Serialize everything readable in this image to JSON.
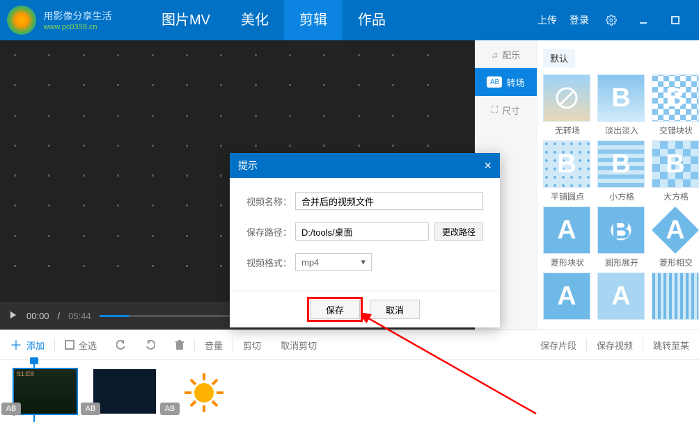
{
  "header": {
    "slogan": "用影像分享生活",
    "url": "www.pc0359.cn",
    "tabs": [
      "图片MV",
      "美化",
      "剪辑",
      "作品"
    ],
    "active_tab": "剪辑",
    "upload": "上传",
    "login": "登录"
  },
  "player": {
    "current": "00:00",
    "total": "05:44"
  },
  "side_tabs": {
    "music": "配乐",
    "transition": "转场",
    "size": "尺寸",
    "active": "转场"
  },
  "gallery": {
    "default_label": "默认",
    "items": [
      "无转场",
      "淡出淡入",
      "交错块状",
      "平铺圆点",
      "小方格",
      "大方格",
      "菱形块状",
      "圆形展开",
      "菱形相交",
      "",
      "",
      ""
    ]
  },
  "toolbar": {
    "add": "添加",
    "select_all": "全选",
    "volume": "音量",
    "cut": "剪切",
    "cancel_cut": "取消剪切",
    "save_segment": "保存片段",
    "save_video": "保存视频",
    "jump": "跳转至某"
  },
  "dialog": {
    "title": "提示",
    "name_label": "视频名称：",
    "name_value": "合并后的视频文件",
    "path_label": "保存路径：",
    "path_value": "D:/tools/桌面",
    "browse": "更改路径",
    "format_label": "视频格式：",
    "format_value": "mp4",
    "save": "保存",
    "cancel": "取消"
  },
  "clip_badge": "AB"
}
